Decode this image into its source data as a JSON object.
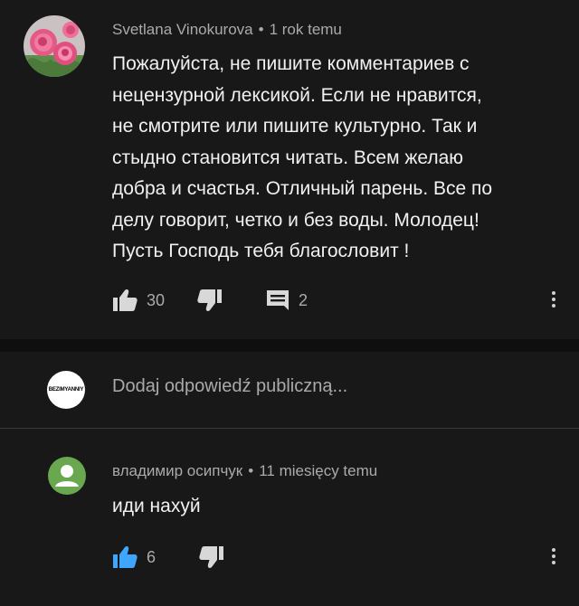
{
  "comments": [
    {
      "author": "Svetlana Vinokurova",
      "time": "1 rok temu",
      "lines": [
        "Пожалуйста, не пишите комментариев с",
        "нецензурной лексикой. Если не нравится,",
        "не смотрите или пишите культурно. Так и",
        "стыдно становится читать. Всем желаю",
        "добра и счастья. Отличный парень. Все по",
        "делу говорит, четко и без воды. Молодец!",
        "Пусть Господь тебя благословит !"
      ],
      "likes": "30",
      "replies": "2"
    },
    {
      "author": "владимир осипчук",
      "time": "11 miesięcy temu",
      "text": "иди нахуй",
      "likes": "6"
    }
  ],
  "reply_box": {
    "placeholder": "Dodaj odpowiedź publiczną...",
    "avatar_label": "BEZIMYANNIY"
  },
  "separator": "•",
  "icons": {
    "like": "thumbs-up-icon",
    "dislike": "thumbs-down-icon",
    "replies": "comment-icon",
    "more": "more-vert-icon"
  },
  "colors": {
    "background": "#181818",
    "liked_accent": "#3ea6ff",
    "avatar_green": "#6aa84f"
  }
}
